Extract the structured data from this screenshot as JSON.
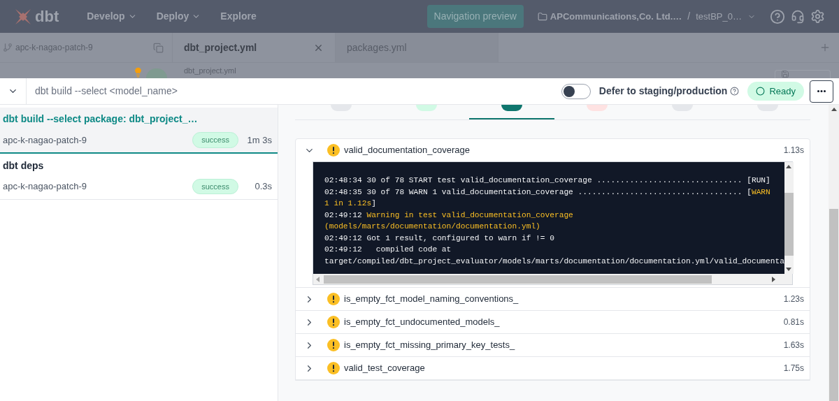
{
  "nav": {
    "logo_text": "dbt",
    "menus": [
      {
        "label": "Develop",
        "dropdown": true
      },
      {
        "label": "Deploy",
        "dropdown": true
      },
      {
        "label": "Explore",
        "dropdown": false
      }
    ],
    "preview_button": "Navigation preview",
    "account": "APCommunications,Co. Ltd.…",
    "separator": "/",
    "project": "testBP_0…"
  },
  "sidebar_header": {
    "branch": "apc-k-nagao-patch-9"
  },
  "editor_tabs": [
    {
      "label": "dbt_project.yml",
      "selected": true
    },
    {
      "label": "packages.yml",
      "selected": false
    }
  ],
  "breadcrumb": "dbt_project.yml",
  "command_bar": {
    "placeholder": "dbt build --select <model_name>",
    "defer": {
      "label": "Defer to staging/production",
      "on": false
    },
    "status": "Ready"
  },
  "runs": [
    {
      "command": "dbt build --select package: dbt_project_…",
      "branch": "apc-k-nagao-patch-9",
      "status": "success",
      "duration": "1m 3s",
      "selected": true
    },
    {
      "command": "dbt deps",
      "branch": "apc-k-nagao-patch-9",
      "status": "success",
      "duration": "0.3s",
      "selected": false
    }
  ],
  "result_tabs": [
    {
      "color": "#e5e7eb",
      "selected": false
    },
    {
      "color": "#d1fae5",
      "selected": false
    },
    {
      "color": "#0f766e",
      "selected": true
    },
    {
      "color": "#fee2e2",
      "selected": false
    },
    {
      "color": "#e5e7eb",
      "selected": false
    },
    {
      "color": "#e5e7eb",
      "selected": false
    }
  ],
  "tests": [
    {
      "name": "valid_documentation_coverage",
      "duration": "1.13s",
      "expanded": true,
      "log": [
        [
          {
            "text": "02:48:34 30 of 78 START test valid_documentation_coverage ............................... [RUN]",
            "kind": "plain"
          }
        ],
        [
          {
            "text": "02:48:35 30 of 78 WARN 1 valid_documentation_coverage ................................... [",
            "kind": "plain"
          },
          {
            "text": "WARN",
            "kind": "warn"
          }
        ],
        [
          {
            "text": "1 in 1.12s",
            "kind": "warn"
          },
          {
            "text": "]",
            "kind": "plain"
          }
        ],
        [
          {
            "text": "02:49:12 ",
            "kind": "plain"
          },
          {
            "text": "Warning in test valid_documentation_coverage",
            "kind": "warn"
          }
        ],
        [
          {
            "text": "(models/marts/documentation/documentation.yml)",
            "kind": "warn"
          }
        ],
        [
          {
            "text": "02:49:12 Got 1 result, configured to warn if != 0",
            "kind": "plain"
          }
        ],
        [
          {
            "text": "02:49:12   compiled code at",
            "kind": "plain"
          }
        ],
        [
          {
            "text": "target/compiled/dbt_project_evaluator/models/marts/documentation/documentation.yml/valid_documenta",
            "kind": "plain"
          }
        ]
      ]
    },
    {
      "name": "is_empty_fct_model_naming_conventions_",
      "duration": "1.23s",
      "expanded": false
    },
    {
      "name": "is_empty_fct_undocumented_models_",
      "duration": "0.81s",
      "expanded": false
    },
    {
      "name": "is_empty_fct_missing_primary_key_tests_",
      "duration": "1.63s",
      "expanded": false
    },
    {
      "name": "valid_test_coverage",
      "duration": "1.75s",
      "expanded": false
    }
  ]
}
